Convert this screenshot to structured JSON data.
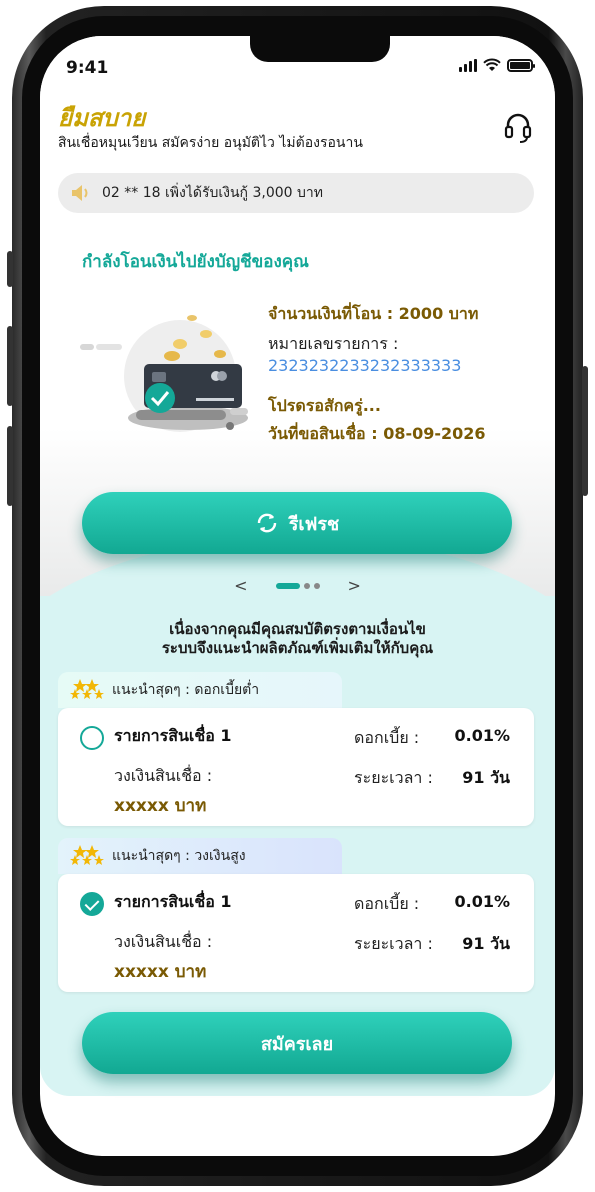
{
  "status_bar": {
    "time": "9:41"
  },
  "header": {
    "brand": "ยืมสบาย",
    "tagline": "สินเชื่อหมุนเวียน สมัครง่าย อนุมัติไว ไม่ต้องรอนาน"
  },
  "ticker": {
    "text": "02 ** 18 เพิ่งได้รับเงินกู้ 3,000 บาท"
  },
  "transfer": {
    "title": "กำลังโอนเงินไปยังบัญชีของคุณ",
    "amount_line": "จำนวนเงินที่โอน : 2000 บาท",
    "ref_label": "หมายเลขรายการ :",
    "ref_value": "2323232233232333333",
    "wait_text": "โปรดรอสักครู่...",
    "request_date": "วันที่ขอสินเชื่อ : 08-09-2026"
  },
  "refresh_button": {
    "label": "รีเฟรช"
  },
  "pager": {
    "prev": "<",
    "next": ">"
  },
  "recommendation": {
    "line1": "เนื่องจากคุณมีคุณสมบัติตรงตามเงื่อนไข",
    "line2": "ระบบจึงแนะนำผลิตภัณฑ์เพิ่มเติมให้กับคุณ"
  },
  "loans": [
    {
      "tag": "แนะนำสุดๆ : ดอกเบี้ยต่ำ",
      "name": "รายการสินเชื่อ 1",
      "rate_label": "ดอกเบี้ย :",
      "rate": "0.01%",
      "limit_label": "วงเงินสินเชื่อ :",
      "limit": "xxxxx บาท",
      "term_label": "ระยะเวลา :",
      "term": "91 วัน",
      "selected": false
    },
    {
      "tag": "แนะนำสุดๆ : วงเงินสูง",
      "name": "รายการสินเชื่อ 1",
      "rate_label": "ดอกเบี้ย :",
      "rate": "0.01%",
      "limit_label": "วงเงินสินเชื่อ :",
      "limit": "xxxxx บาท",
      "term_label": "ระยะเวลา :",
      "term": "91 วัน",
      "selected": true
    }
  ],
  "apply_button": {
    "label": "สมัครเลย"
  },
  "colors": {
    "accent": "#14a898",
    "brand": "#c9a304",
    "gold_text": "#7a5a04",
    "link": "#4a8ee0"
  }
}
